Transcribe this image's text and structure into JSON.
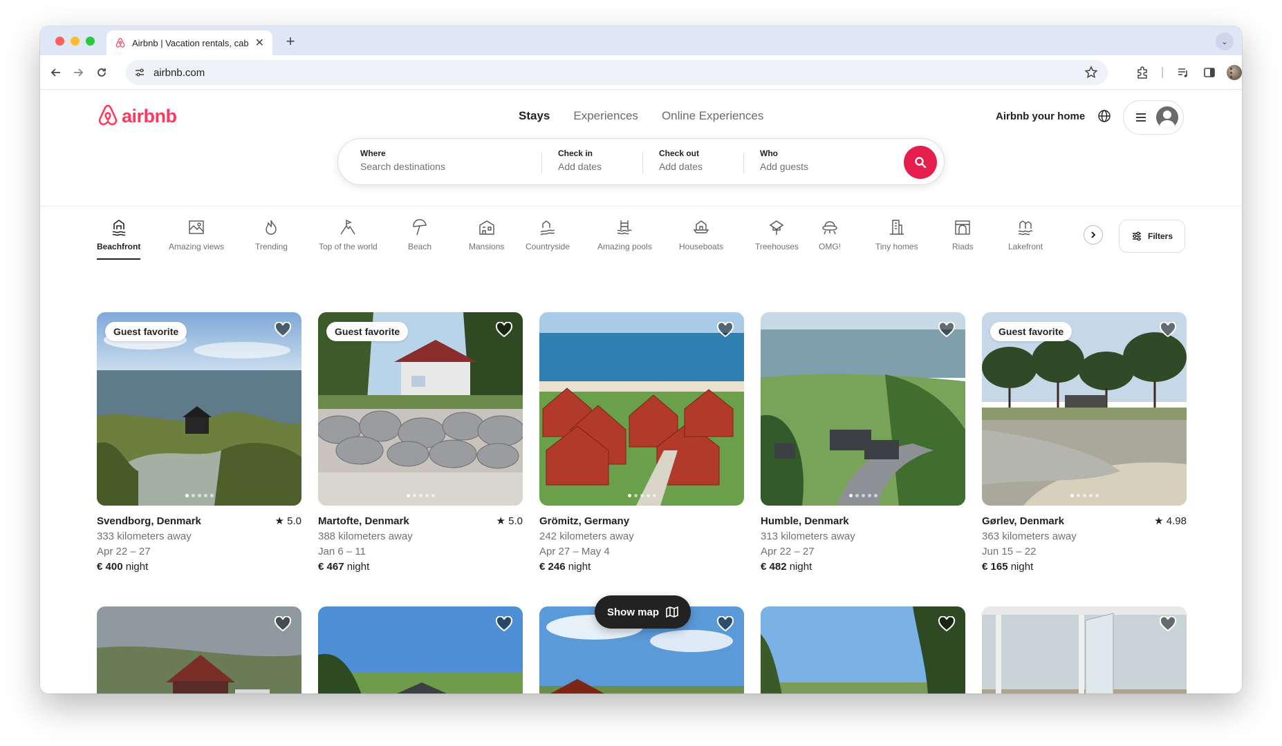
{
  "browser": {
    "tab_title": "Airbnb | Vacation rentals, cab",
    "url": "airbnb.com"
  },
  "header": {
    "logo_text": "airbnb",
    "nav": [
      "Stays",
      "Experiences",
      "Online Experiences"
    ],
    "host_link": "Airbnb your home"
  },
  "search": {
    "where_label": "Where",
    "where_placeholder": "Search destinations",
    "checkin_label": "Check in",
    "checkin_placeholder": "Add dates",
    "checkout_label": "Check out",
    "checkout_placeholder": "Add dates",
    "who_label": "Who",
    "who_placeholder": "Add guests"
  },
  "categories": [
    "Beachfront",
    "Amazing views",
    "Trending",
    "Top of the world",
    "Beach",
    "Mansions",
    "Countryside",
    "Amazing pools",
    "Houseboats",
    "Treehouses",
    "OMG!",
    "Tiny homes",
    "Riads",
    "Lakefront"
  ],
  "filters_label": "Filters",
  "listings": [
    {
      "badge": "Guest favorite",
      "location": "Svendborg, Denmark",
      "rating": "5.0",
      "distance": "333 kilometers away",
      "dates": "Apr 22 – 27",
      "price": "€ 400",
      "unit": "night"
    },
    {
      "badge": "Guest favorite",
      "location": "Martofte, Denmark",
      "rating": "5.0",
      "distance": "388 kilometers away",
      "dates": "Jan 6 – 11",
      "price": "€ 467",
      "unit": "night"
    },
    {
      "badge": "",
      "location": "Grömitz, Germany",
      "rating": "",
      "distance": "242 kilometers away",
      "dates": "Apr 27 – May 4",
      "price": "€ 246",
      "unit": "night"
    },
    {
      "badge": "",
      "location": "Humble, Denmark",
      "rating": "",
      "distance": "313 kilometers away",
      "dates": "Apr 22 – 27",
      "price": "€ 482",
      "unit": "night"
    },
    {
      "badge": "Guest favorite",
      "location": "Gørlev, Denmark",
      "rating": "4.98",
      "distance": "363 kilometers away",
      "dates": "Jun 15 – 22",
      "price": "€ 165",
      "unit": "night"
    }
  ],
  "show_map_label": "Show map",
  "colors": {
    "brand": "#ff385c",
    "search_button": "#e61e4d"
  }
}
